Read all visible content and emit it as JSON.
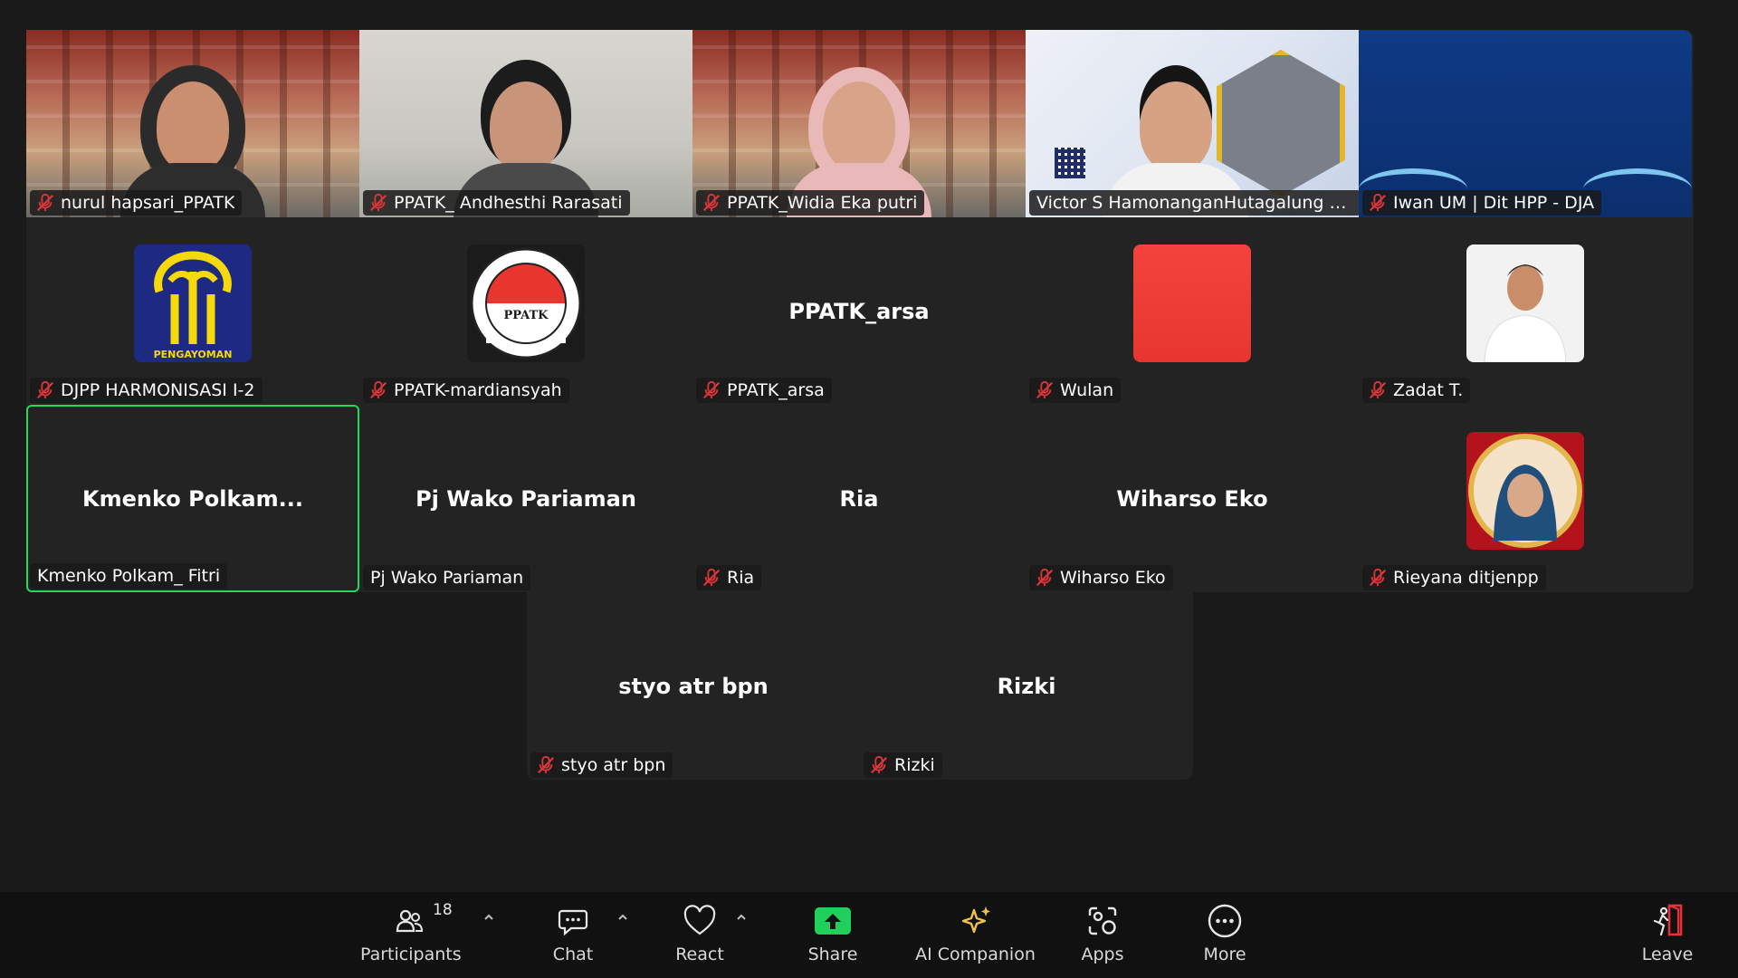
{
  "row1": [
    {
      "name": "nurul hapsari_PPATK",
      "muted": true
    },
    {
      "name": "PPATK_ Andhesthi Rarasati",
      "muted": true
    },
    {
      "name": "PPATK_Widia Eka putri",
      "muted": true
    },
    {
      "name": "Victor S HamonanganHutagalung H...",
      "muted": false
    },
    {
      "name": "Iwan UM | Dit HPP - DJA",
      "muted": true
    }
  ],
  "row2": [
    {
      "name": "DJPP HARMONISASI I-2",
      "avatar_text": "PENGAYOMAN"
    },
    {
      "name": "PPATK-mardiansyah",
      "avatar_text": "PPATK"
    },
    {
      "name": "PPATK_arsa",
      "display": "PPATK_arsa"
    },
    {
      "name": "Wulan"
    },
    {
      "name": "Zadat T."
    }
  ],
  "row3": [
    {
      "name": "Kmenko Polkam_ Fitri",
      "display": "Kmenko  Polkam..."
    },
    {
      "name": "Pj Wako Pariaman",
      "display": "Pj Wako Pariaman"
    },
    {
      "name": "Ria",
      "display": "Ria"
    },
    {
      "name": "Wiharso Eko",
      "display": "Wiharso Eko"
    },
    {
      "name": "Rieyana ditjenpp"
    }
  ],
  "row4": [
    {
      "name": "styo atr bpn",
      "display": "styo atr bpn"
    },
    {
      "name": "Rizki",
      "display": "Rizki"
    }
  ],
  "toolbar": {
    "participants_label": "Participants",
    "participants_count": "18",
    "chat_label": "Chat",
    "react_label": "React",
    "share_label": "Share",
    "ai_label": "AI Companion",
    "apps_label": "Apps",
    "more_label": "More",
    "leave_label": "Leave"
  },
  "colors": {
    "active_speaker": "#23d959",
    "share_green": "#1fd15a",
    "muted_red": "#e0353a",
    "ai_gold": "#f0c24b",
    "leave_red": "#e5323a"
  }
}
